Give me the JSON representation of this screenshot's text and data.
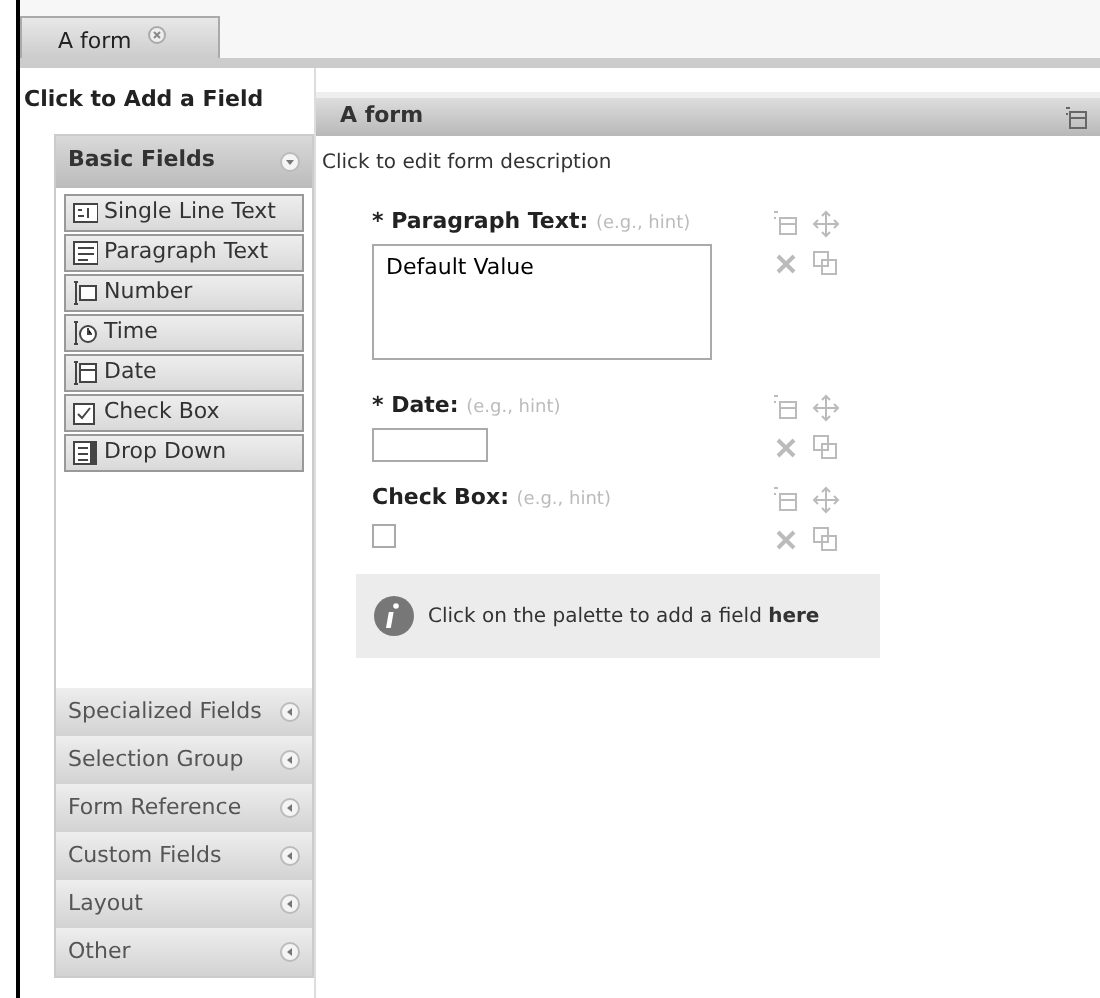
{
  "tabs": [
    {
      "label": "A form",
      "selected": true
    }
  ],
  "palette": {
    "title": "Click to Add a Field",
    "sections": [
      {
        "label": "Basic Fields",
        "expanded": true,
        "items": [
          "Single Line Text",
          "Paragraph Text",
          "Number",
          "Time",
          "Date",
          "Check Box",
          "Drop Down"
        ]
      },
      {
        "label": "Specialized Fields",
        "expanded": false
      },
      {
        "label": "Selection Group",
        "expanded": false
      },
      {
        "label": "Form Reference",
        "expanded": false
      },
      {
        "label": "Custom Fields",
        "expanded": false
      },
      {
        "label": "Layout",
        "expanded": false
      },
      {
        "label": "Other",
        "expanded": false
      }
    ]
  },
  "form": {
    "title": "A form",
    "description": "Click to edit form description",
    "fields": [
      {
        "kind": "textarea",
        "label": "* Paragraph Text:",
        "hint": "(e.g., hint)",
        "value": "Default Value"
      },
      {
        "kind": "input",
        "label": "* Date:",
        "hint": "(e.g., hint)"
      },
      {
        "kind": "checkbox",
        "label": "Check Box:",
        "hint": "(e.g., hint)",
        "checked": false
      }
    ],
    "info": "Click on the palette to add a field **here**"
  }
}
